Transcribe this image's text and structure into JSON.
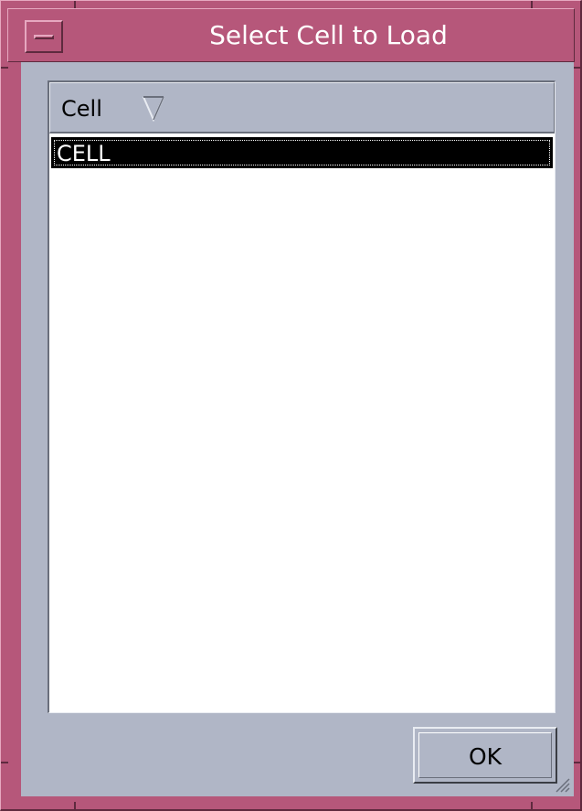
{
  "window": {
    "title": "Select Cell to Load",
    "icons": {
      "window_menu": "window-menu-icon",
      "sort": "sort-descending-triangle-icon",
      "resize": "resize-grip-icon"
    }
  },
  "list": {
    "column_header": "Cell",
    "rows": [
      {
        "label": "CELL",
        "selected": true
      }
    ]
  },
  "buttons": {
    "ok_label": "OK"
  },
  "colors": {
    "title_bar": "#b6577a",
    "client_background": "#b0b6c6",
    "selection_background": "#000000",
    "selection_text": "#ffffff"
  }
}
